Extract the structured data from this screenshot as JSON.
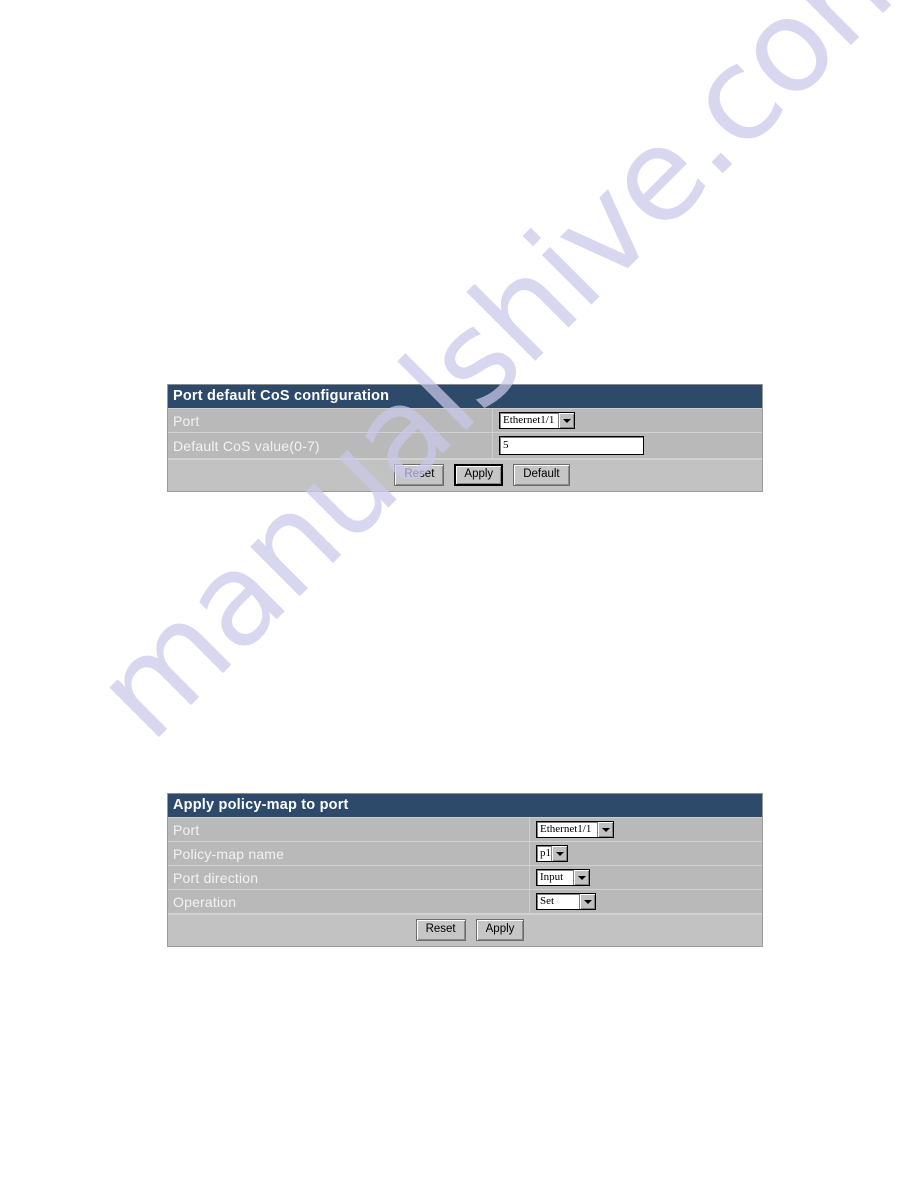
{
  "page": {
    "background_color": "#ffffff",
    "watermark": "manualshive.com",
    "watermark_color": "#c9c9ea"
  },
  "theme": {
    "header_bg": "#2e4a6b",
    "header_text": "#ffffff",
    "row_bg": "#b9b9b9",
    "row_divider": "#d2d2d2",
    "label_text": "#f2f2f2",
    "button_bg": "#c6c6c6",
    "field_bg": "#ffffff"
  },
  "panels": [
    {
      "id": "port-default-cos-configuration",
      "title": "Port default CoS configuration",
      "rows": [
        {
          "label": "Port",
          "control": "dropdown",
          "value": "Ethernet1/1"
        },
        {
          "label": "Default CoS value(0-7)",
          "control": "textbox",
          "value": "5",
          "placeholder": ""
        }
      ],
      "buttons": [
        {
          "label": "Reset",
          "focused": false
        },
        {
          "label": "Apply",
          "focused": true
        },
        {
          "label": "Default",
          "focused": false
        }
      ]
    },
    {
      "id": "apply-policy-map-to-port",
      "title": "Apply policy-map to port",
      "rows": [
        {
          "label": "Port",
          "control": "dropdown",
          "value": "Ethernet1/1"
        },
        {
          "label": "Policy-map name",
          "control": "dropdown",
          "value": "p1"
        },
        {
          "label": "Port direction",
          "control": "dropdown",
          "value": "Input"
        },
        {
          "label": "Operation",
          "control": "dropdown",
          "value": "Set"
        }
      ],
      "buttons": [
        {
          "label": "Reset",
          "focused": false
        },
        {
          "label": "Apply",
          "focused": false
        }
      ]
    }
  ],
  "icons": {
    "dropdown_arrow": "chevron-down-icon"
  }
}
